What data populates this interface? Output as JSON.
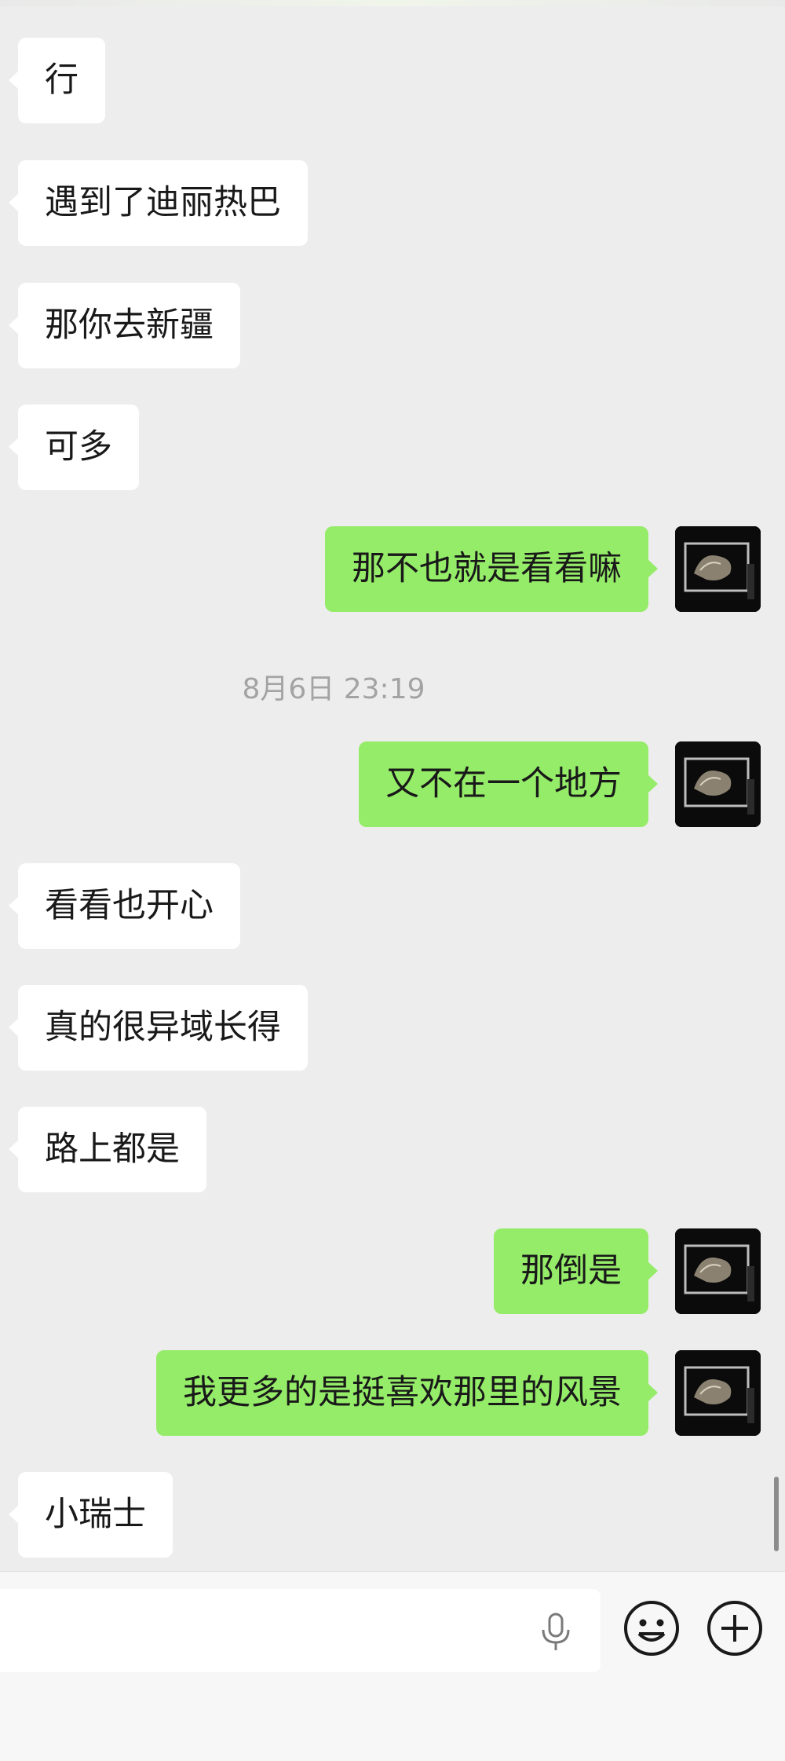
{
  "messages": [
    {
      "side": "left",
      "text": "行"
    },
    {
      "side": "left",
      "text": "遇到了迪丽热巴"
    },
    {
      "side": "left",
      "text": "那你去新疆"
    },
    {
      "side": "left",
      "text": "可多"
    },
    {
      "side": "right",
      "text": "那不也就是看看嘛"
    },
    {
      "side": "right",
      "text": "又不在一个地方"
    },
    {
      "side": "left",
      "text": "看看也开心"
    },
    {
      "side": "left",
      "text": "真的很异域长得"
    },
    {
      "side": "left",
      "text": "路上都是"
    },
    {
      "side": "right",
      "text": "那倒是"
    },
    {
      "side": "right",
      "text": "我更多的是挺喜欢那里的风景"
    },
    {
      "side": "left",
      "text": "小瑞士"
    }
  ],
  "timestamp": "8月6日 23:19",
  "colors": {
    "sent_bubble": "#95ec69",
    "received_bubble": "#ffffff",
    "background": "#ededed"
  },
  "icons": {
    "voice": "microphone-icon",
    "emoji": "emoji-icon",
    "more": "plus-icon"
  }
}
